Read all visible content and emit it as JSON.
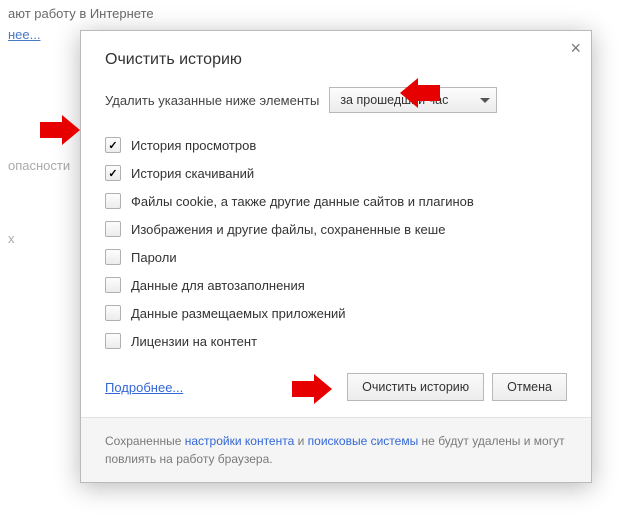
{
  "background": {
    "line1": "ают работу в Интернете",
    "more_link": "нее...",
    "word1": "опасности",
    "word2": "х"
  },
  "dialog": {
    "title": "Очистить историю",
    "close_glyph": "×",
    "prompt": "Удалить указанные ниже элементы",
    "time_range": {
      "selected": "за прошедший час"
    },
    "items": [
      {
        "label": "История просмотров",
        "checked": true
      },
      {
        "label": "История скачиваний",
        "checked": true
      },
      {
        "label": "Файлы cookie, а также другие данные сайтов и плагинов",
        "checked": false
      },
      {
        "label": "Изображения и другие файлы, сохраненные в кеше",
        "checked": false
      },
      {
        "label": "Пароли",
        "checked": false
      },
      {
        "label": "Данные для автозаполнения",
        "checked": false
      },
      {
        "label": "Данные размещаемых приложений",
        "checked": false
      },
      {
        "label": "Лицензии на контент",
        "checked": false
      }
    ],
    "more_link": "Подробнее...",
    "primary_button": "Очистить историю",
    "cancel_button": "Отмена",
    "footer": {
      "t1": "Сохраненные ",
      "link1": "настройки контента",
      "t2": " и ",
      "link2": "поисковые системы",
      "t3": " не будут удалены и могут повлиять на работу браузера."
    }
  }
}
